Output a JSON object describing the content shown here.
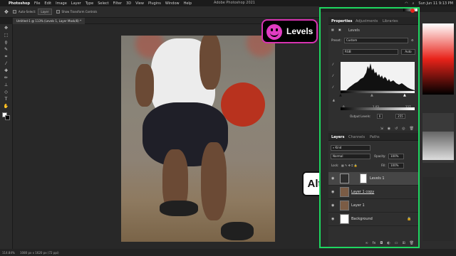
{
  "menubar": {
    "app": "Photoshop",
    "items": [
      "File",
      "Edit",
      "Image",
      "Layer",
      "Type",
      "Select",
      "Filter",
      "3D",
      "View",
      "Plugins",
      "Window",
      "Help"
    ],
    "window_title": "Adobe Photoshop 2021",
    "clock": "Sun Jun 11  9:13 PM"
  },
  "optbar": {
    "auto_select": "Auto-Select:",
    "auto_select_value": "Layer",
    "show_transform": "Show Transform Controls"
  },
  "document": {
    "tab_label": "Untitled-1 @ 113% (Levels 1, Layer Mask/8) *"
  },
  "status": {
    "zoom": "114.84%",
    "doc_info": "1080 px x 1620 px (72 ppi)"
  },
  "badges": {
    "levels": "Levels",
    "alt": "Alt"
  },
  "properties": {
    "tabs": [
      "Properties",
      "Adjustments",
      "Libraries"
    ],
    "title": "Levels",
    "preset_label": "Preset:",
    "preset_value": "Custom",
    "channel_value": "RGB",
    "auto_button": "Auto",
    "input_black": "0",
    "input_mid": "1.03",
    "input_white": "227",
    "output_label": "Output Levels:",
    "output_black": "0",
    "output_white": "255"
  },
  "layers": {
    "tabs": [
      "Layers",
      "Channels",
      "Paths"
    ],
    "kind_label": "Kind",
    "blend_mode": "Normal",
    "opacity_label": "Opacity:",
    "opacity_value": "100%",
    "lock_label": "Lock:",
    "fill_label": "Fill:",
    "fill_value": "100%",
    "rows": [
      "Levels 1",
      "Layer 1 copy",
      "Layer 1",
      "Background"
    ]
  },
  "colors": {
    "highlight_frame": "#1ed760",
    "badge_accent": "#d933b2"
  }
}
